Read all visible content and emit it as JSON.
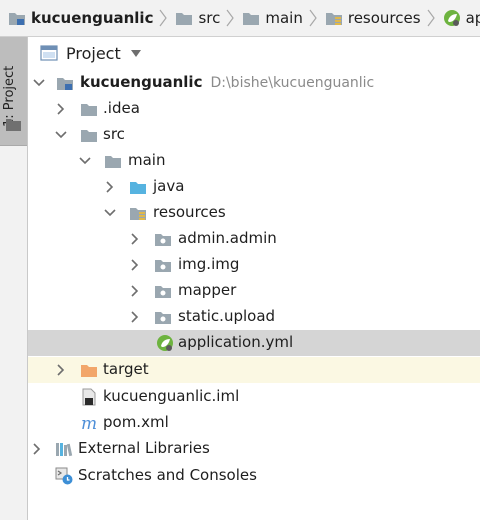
{
  "breadcrumb": {
    "items": [
      {
        "label": "kucuenguanlic",
        "icon": "module-folder-icon"
      },
      {
        "label": "src",
        "icon": "folder-icon"
      },
      {
        "label": "main",
        "icon": "folder-icon"
      },
      {
        "label": "resources",
        "icon": "resources-folder-icon"
      },
      {
        "label": "applica",
        "icon": "spring-config-icon"
      }
    ]
  },
  "tool_strip": {
    "tab_label": "1: Project",
    "icon": "folder-icon"
  },
  "panel": {
    "title": "Project",
    "view_dropdown_icon": "triangle-down-icon"
  },
  "tree": {
    "root": {
      "label": "kucuenguanlic",
      "path": "D:\\bishe\\kucuenguanlic"
    },
    "idea": "idea",
    "idea_prefix": ".",
    "src": "src",
    "main": "main",
    "java": "java",
    "resources": "resources",
    "admin": "admin.admin",
    "img": "img.img",
    "mapper": "mapper",
    "static_upload": "static.upload",
    "application": "application.yml",
    "target": "target",
    "iml": "kucuenguanlic.iml",
    "pom": "pom.xml",
    "external": "External Libraries",
    "scratches": "Scratches and Consoles"
  },
  "colors": {
    "folder": "#9aa7b0",
    "source_folder": "#56b3e0",
    "excluded_folder": "#f2a66a",
    "spring_green": "#6db33f",
    "maven_blue": "#4e8fd8",
    "selection": "#d5d5d5",
    "highlight": "#fbf8e3"
  }
}
